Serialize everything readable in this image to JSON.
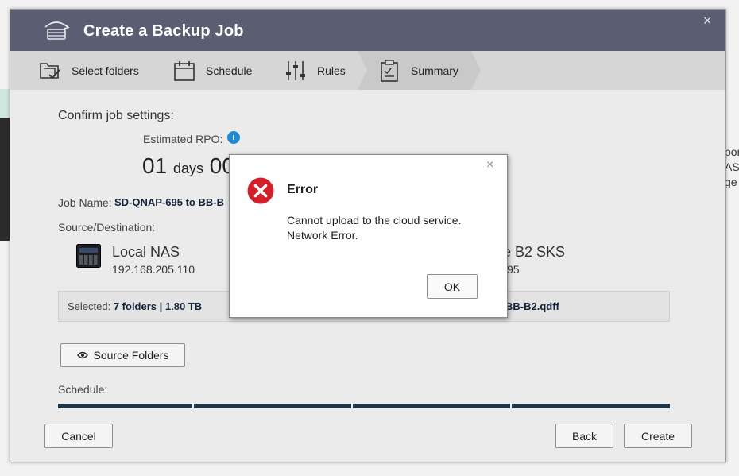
{
  "background": {
    "right_text": [
      "por",
      "AS",
      "ge"
    ]
  },
  "modal": {
    "title": "Create a Backup Job",
    "close_glyph": "×",
    "steps": [
      {
        "label": "Select folders",
        "icon": "folder-check-icon"
      },
      {
        "label": "Schedule",
        "icon": "calendar-icon"
      },
      {
        "label": "Rules",
        "icon": "sliders-icon"
      },
      {
        "label": "Summary",
        "icon": "clipboard-icon"
      }
    ],
    "active_step": "Summary",
    "confirm_label": "Confirm job settings:",
    "rpo": {
      "label": "Estimated RPO:",
      "days_value": "01",
      "days_unit": "days",
      "hours_value": "00"
    },
    "job_name": {
      "label": "Job Name:",
      "value": "SD-QNAP-695 to BB-B"
    },
    "source_destination_label": "Source/Destination:",
    "source": {
      "name": "Local NAS",
      "address": "192.168.205.110"
    },
    "destination": {
      "name": "e B2 SKS",
      "sub": "95"
    },
    "selected": {
      "label": "Selected:",
      "folders": "7 folders",
      "separator": "|",
      "size": "1.80 TB",
      "file": "BB-B2.qdff"
    },
    "source_folders_button": "Source Folders",
    "schedule_label": "Schedule:",
    "buttons": {
      "cancel": "Cancel",
      "back": "Back",
      "create": "Create"
    }
  },
  "error_dialog": {
    "title": "Error",
    "close_glyph": "×",
    "message_line1": "Cannot upload to the cloud service.",
    "message_line2": "Network Error.",
    "ok": "OK"
  },
  "colors": {
    "header": "#5b5e72",
    "steps_bar": "#d6d6d6",
    "error_red": "#d32028",
    "info_blue": "#1d8bd9",
    "schedule_bar": "#1f3447"
  }
}
